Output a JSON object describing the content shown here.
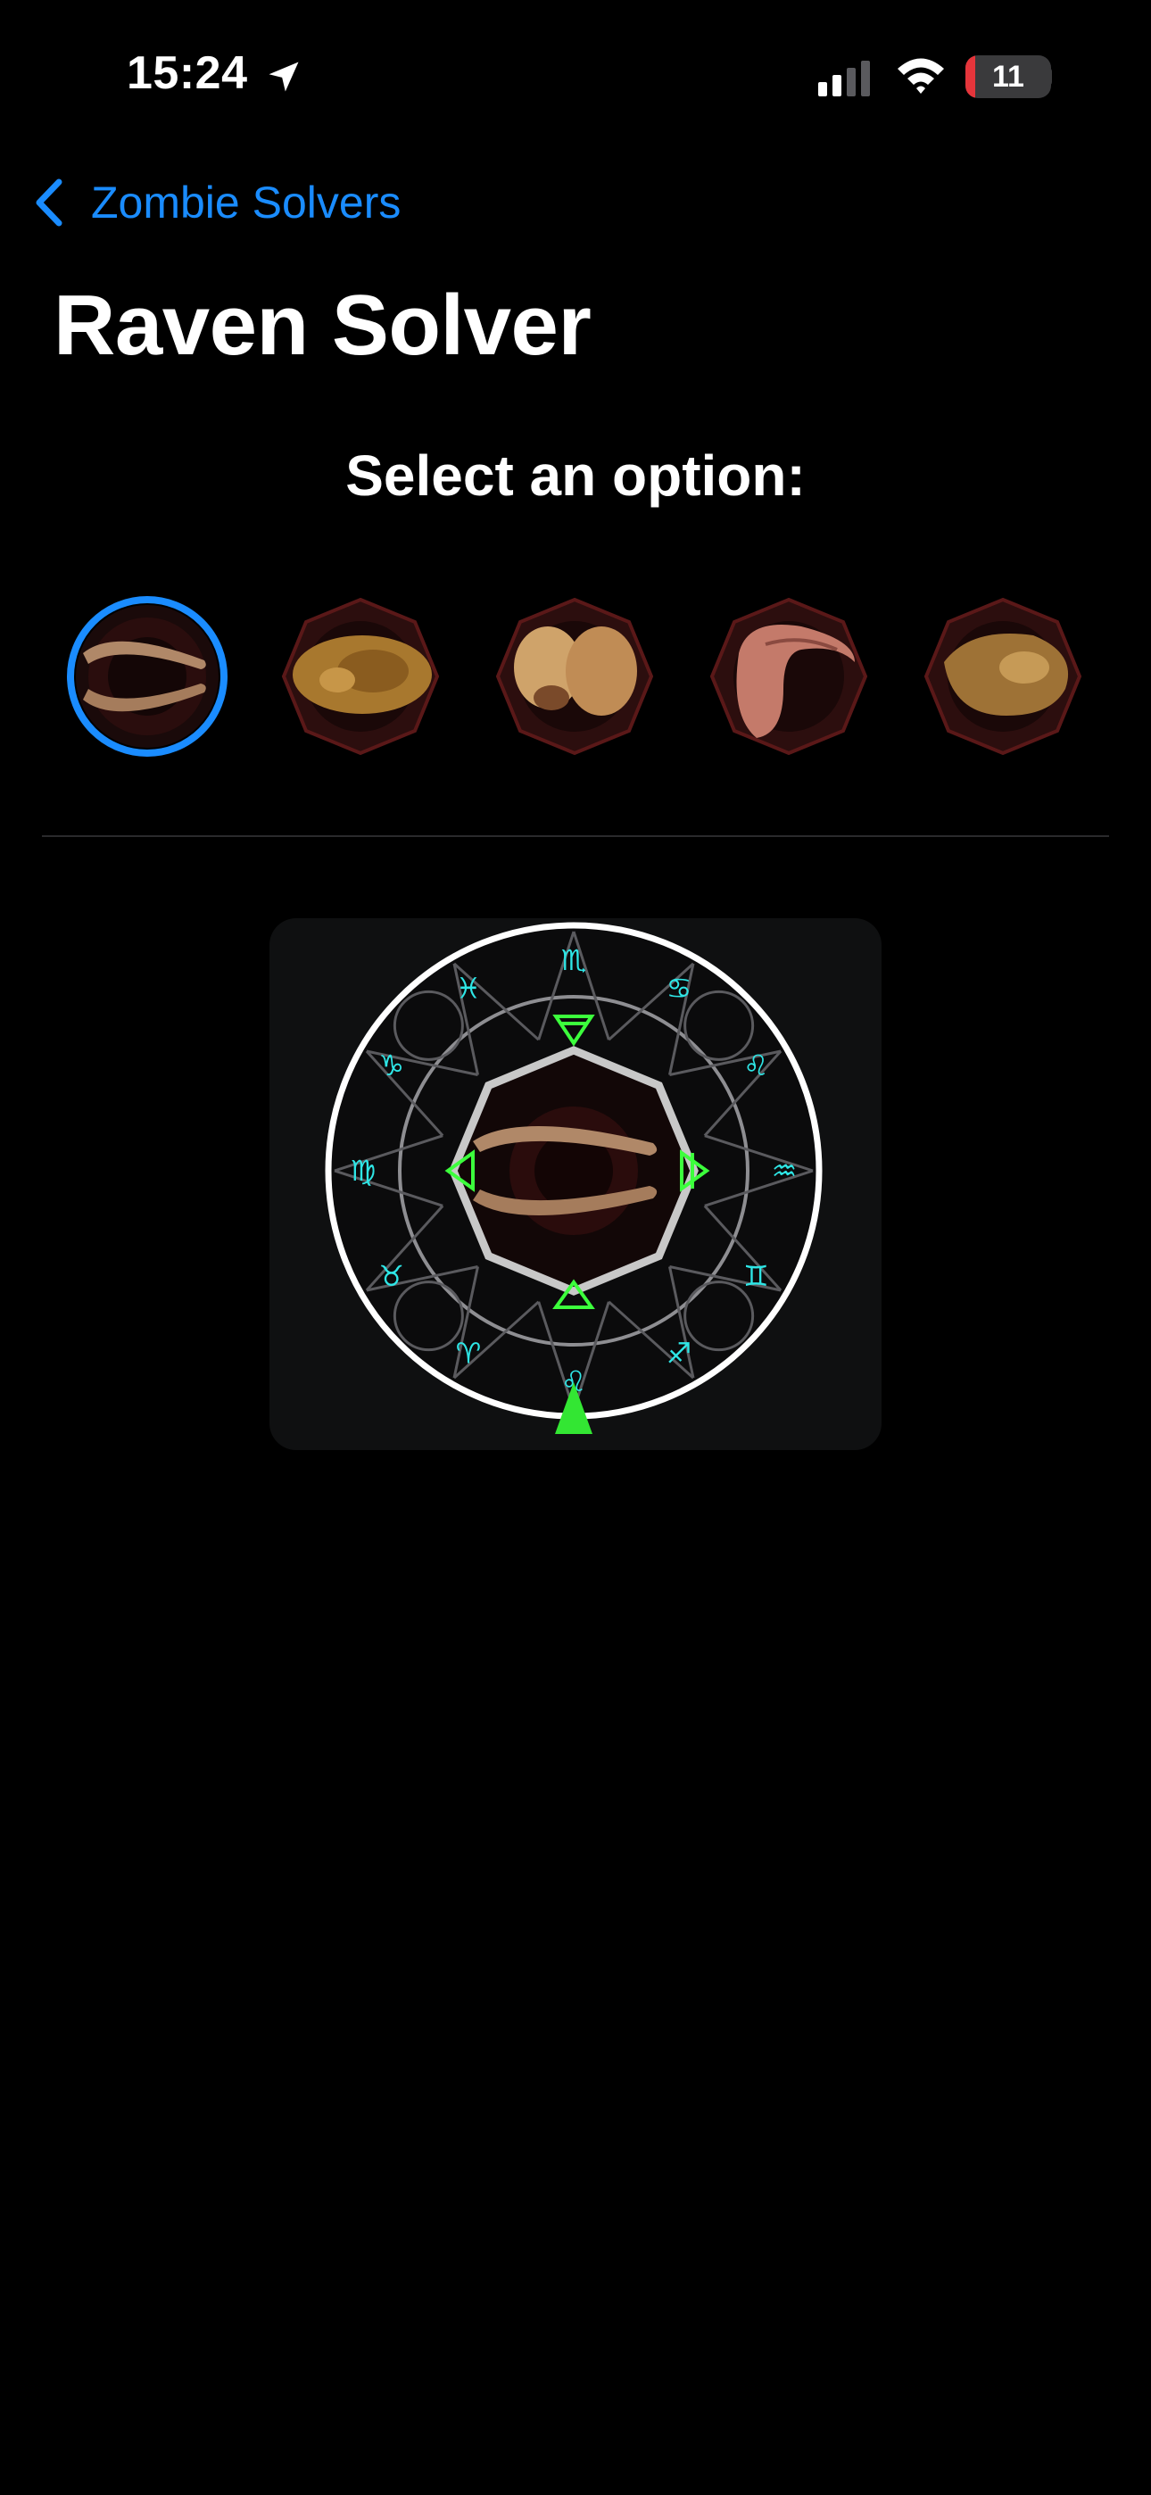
{
  "status_bar": {
    "time": "15:24",
    "battery": "11",
    "battery_level": 0.11
  },
  "nav": {
    "back_label": "Zombie Solvers"
  },
  "page": {
    "title": "Raven Solver",
    "prompt": "Select an option:"
  },
  "options": [
    {
      "name": "jaw-bone",
      "selected": true
    },
    {
      "name": "skull",
      "selected": false
    },
    {
      "name": "bone-pair",
      "selected": false
    },
    {
      "name": "horn",
      "selected": false
    },
    {
      "name": "flesh",
      "selected": false
    }
  ],
  "wheel": {
    "zodiac_symbols": [
      "♏",
      "♋",
      "♌",
      "♒",
      "♊",
      "♐",
      "♌",
      "♈",
      "♉",
      "♍",
      "♑",
      "♓"
    ],
    "element_triangles": [
      "water",
      "air",
      "fire",
      "earth"
    ],
    "center_item": "jaw-bone",
    "colors": {
      "zodiac": "#2ee6e6",
      "element": "#3cff3c",
      "accent": "#1a8cff",
      "pointer": "#33e633"
    }
  }
}
